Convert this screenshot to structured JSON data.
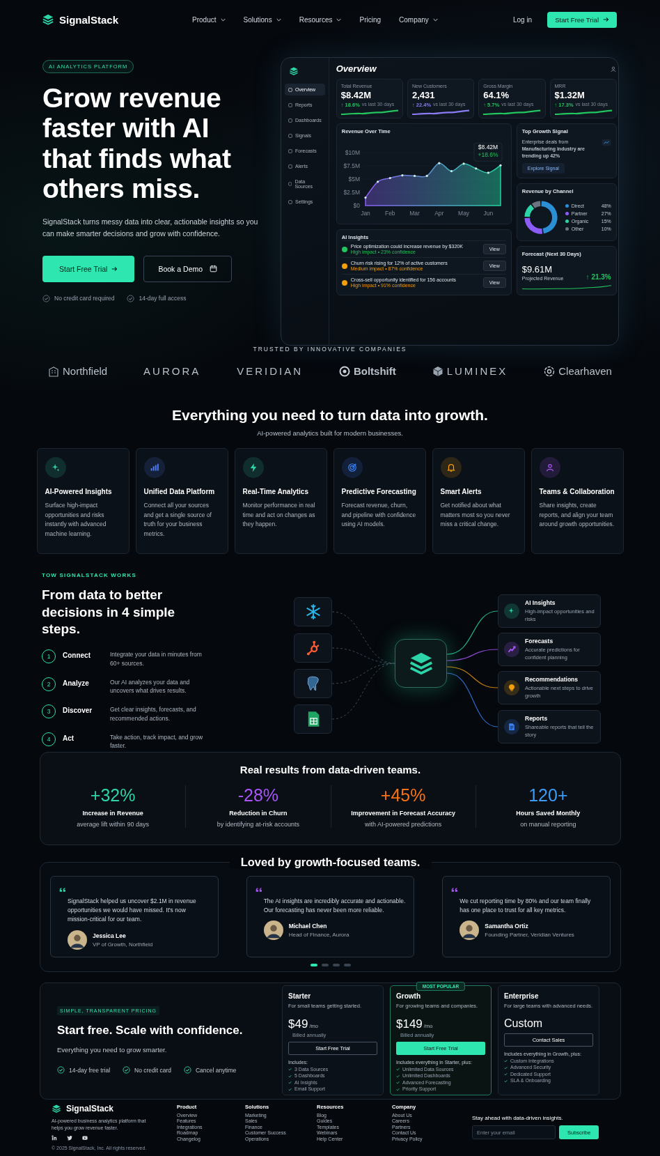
{
  "nav": {
    "brand": "SignalStack",
    "links": [
      {
        "label": "Product",
        "dropdown": true
      },
      {
        "label": "Solutions",
        "dropdown": true
      },
      {
        "label": "Resources",
        "dropdown": true
      },
      {
        "label": "Pricing",
        "dropdown": false
      },
      {
        "label": "Company",
        "dropdown": true
      }
    ],
    "login": "Log in",
    "cta": "Start Free Trial"
  },
  "hero": {
    "badge": "AI ANALYTICS PLATFORM",
    "headline": "Grow revenue faster **with AI that finds what others miss.**",
    "description": "SignalStack turns messy data into clear, actionable insights so you can make smarter decisions and grow with confidence.",
    "primary_button": "Start Free Trial",
    "secondary_button": "Book a Demo",
    "assurances": [
      "No credit card required",
      "14-day full access"
    ]
  },
  "dashboard": {
    "title": "Overview",
    "sidebar": [
      {
        "label": "Overview",
        "selected": true
      },
      {
        "label": "Reports",
        "selected": false
      },
      {
        "label": "Dashboards",
        "selected": false
      },
      {
        "label": "Signals",
        "selected": false
      },
      {
        "label": "Forecasts",
        "selected": false
      },
      {
        "label": "Alerts",
        "selected": false
      },
      {
        "label": "Data Sources",
        "selected": false
      },
      {
        "label": "Settings",
        "selected": false
      }
    ],
    "kpis": [
      {
        "label": "Total Revenue",
        "value": "$8.42M",
        "change": "↑ 18.6%",
        "note": "vs last 30 days",
        "color": "#22c55e"
      },
      {
        "label": "New Customers",
        "value": "2,431",
        "change": "↑ 22.4%",
        "note": "vs last 30 days",
        "color": "#8b7cf6"
      },
      {
        "label": "Gross Margin",
        "value": "64.1%",
        "change": "↑ 5.7%",
        "note": "vs last 30 days",
        "color": "#22c55e"
      },
      {
        "label": "MRR",
        "value": "$1.32M",
        "change": "↑ 17.3%",
        "note": "vs last 30 days",
        "color": "#22c55e"
      }
    ],
    "revenue_chart": {
      "title": "Revenue Over Time",
      "chart_data": {
        "type": "area",
        "categories": [
          "Jan",
          null,
          "Feb",
          null,
          "Mar",
          null,
          "Apr",
          null,
          "May",
          null,
          "Jun",
          null
        ],
        "series": [
          {
            "color": "#22d3a0",
            "values": [
              1.5,
              4.5,
              5.2,
              5.7,
              5.6,
              5.6,
              8.0,
              6.5,
              7.9,
              7.0,
              6.2,
              7.6
            ]
          }
        ],
        "ylim": [
          0,
          10
        ],
        "yticks": [
          {
            "value": 0,
            "label": "$0"
          },
          {
            "value": 2.5,
            "label": "$2.5M"
          },
          {
            "value": 5,
            "label": "$5M"
          },
          {
            "value": 7.5,
            "label": "$7.5M"
          },
          {
            "value": 10,
            "label": "$10M"
          }
        ],
        "annotations": [
          "$8.42M",
          "+18.6%"
        ]
      }
    },
    "growth_signal": {
      "title": "Top Growth Signal",
      "text": "Enterprise deals from **Manufacturing industry are trending up 42%**",
      "button": "Explore Signal"
    },
    "channels": {
      "title": "Revenue by Channel",
      "chart_data": {
        "type": "donut",
        "categories": [
          "Direct",
          "Partner",
          "Organic",
          "Other"
        ],
        "values": [
          48,
          27,
          15,
          10
        ],
        "value_labels": [
          "48%",
          "27%",
          "15%",
          "10%"
        ],
        "colors": [
          "#2b8fd6",
          "#8b5cf6",
          "#2dd4a8",
          "#6b7280"
        ]
      }
    },
    "insights": {
      "title": "AI Insights",
      "items": [
        {
          "text": "Price optimization could increase revenue by $320K",
          "meta": "High impact • 23% confidence",
          "color": "#22c55e",
          "button": "View"
        },
        {
          "text": "Churn risk rising for 12% of active customers",
          "meta": "Medium impact • 87% confidence",
          "color": "#f59e0b",
          "button": "View"
        },
        {
          "text": "Cross-sell opportunity identified for 156 accounts",
          "meta": "High impact • 91% confidence",
          "color": "#f59e0b",
          "button": "View"
        }
      ]
    },
    "forecast": {
      "title": "Forecast (Next 30 Days)",
      "value": "$9.61M",
      "label": "Projected Revenue",
      "change": "↑ 21.3%"
    }
  },
  "trusted": {
    "label": "TRUSTED BY INNOVATIVE COMPANIES",
    "logos": [
      "Northfield",
      "AURORA",
      "VERIDIAN",
      "Boltshift",
      "LUMINEX",
      "Clearhaven"
    ]
  },
  "features": {
    "title": "Everything you need to turn data into growth.",
    "subtitle": "AI-powered analytics built for modern businesses.",
    "cards": [
      {
        "title": "AI-Powered Insights",
        "text": "Surface high-impact opportunities and risks instantly with advanced machine learning.",
        "color": "#2dd4a8"
      },
      {
        "title": "Unified Data Platform",
        "text": "Connect all your sources and get a single source of truth for your business metrics.",
        "color": "#4f7df0"
      },
      {
        "title": "Real-Time Analytics",
        "text": "Monitor performance in real time and act on changes as they happen.",
        "color": "#2dd4a8"
      },
      {
        "title": "Predictive Forecasting",
        "text": "Forecast revenue, churn, and pipeline with confidence using AI models.",
        "color": "#3b82f6"
      },
      {
        "title": "Smart Alerts",
        "text": "Get notified about what matters most so you never miss a critical change.",
        "color": "#f59e0b"
      },
      {
        "title": "Teams & Collaboration",
        "text": "Share insights, create reports, and align your team around growth opportunities.",
        "color": "#a855f7"
      }
    ]
  },
  "how": {
    "eyebrow": "TOW SIGNALSTACK WORKS",
    "title": "From data to better decisions in 4 simple steps.",
    "steps": [
      {
        "number": "1",
        "title": "Connect",
        "text": "Integrate your data in minutes from 60+ sources."
      },
      {
        "number": "2",
        "title": "Analyze",
        "text": "Our AI analyzes your data and uncovers what drives results."
      },
      {
        "number": "3",
        "title": "Discover",
        "text": "Get clear insights, forecasts, and recommended actions."
      },
      {
        "number": "4",
        "title": "Act",
        "text": "Take action, track impact, and grow faster."
      }
    ],
    "outputs": [
      {
        "title": "AI Insights",
        "text": "High-impact opportunities and risks",
        "color": "#2dd4a8"
      },
      {
        "title": "Forecasts",
        "text": "Accurate predictions for confident planning",
        "color": "#a855f7"
      },
      {
        "title": "Recommendations",
        "text": "Actionable next steps to drive growth",
        "color": "#f59e0b"
      },
      {
        "title": "Reports",
        "text": "Shareable reports that tell the story",
        "color": "#3b82f6"
      }
    ]
  },
  "results": {
    "title": "Real results from data-driven teams.",
    "stats": [
      {
        "value": "+32%",
        "label": "Increase in Revenue",
        "note": "average lift within 90 days",
        "color": "#2dd4a8"
      },
      {
        "value": "-28%",
        "label": "Reduction in Churn",
        "note": "by identifying at-risk accounts",
        "color": "#a855f7"
      },
      {
        "value": "+45%",
        "label": "Improvement in Forecast Accuracy",
        "note": "with AI-powered predictions",
        "color": "#f97316"
      },
      {
        "value": "120+",
        "label": "Hours Saved Monthly",
        "note": "on manual reporting",
        "color": "#3b9cf6"
      }
    ]
  },
  "testimonials": {
    "title": "Loved by growth-focused teams.",
    "items": [
      {
        "quote": "SignalStack helped us uncover $2.1M in revenue opportunities we would have missed. It's now mission-critical for our team.",
        "name": "Jessica Lee",
        "role": "VP of Growth, Northfield",
        "color": "#2dd4a8"
      },
      {
        "quote": "The AI insights are incredibly accurate and actionable. Our forecasting has never been more reliable.",
        "name": "Michael Chen",
        "role": "Head of Finance, Aurora",
        "color": "#a855f7"
      },
      {
        "quote": "We cut reporting time by 80% and our team finally has one place to trust for all key metrics.",
        "name": "Samantha Ortiz",
        "role": "Founding Partner, Veridian Ventures",
        "color": "#a855f7"
      }
    ],
    "dots": [
      {
        "selected": true
      },
      {
        "selected": false
      },
      {
        "selected": false
      },
      {
        "selected": false
      }
    ]
  },
  "pricing": {
    "eyebrow": "SIMPLE, TRANSPARENT PRICING",
    "title": "Start free. Scale with confidence.",
    "subtitle": "Everything you need to grow smarter.",
    "perks": [
      "14-day free trial",
      "No credit card",
      "Cancel anytime"
    ],
    "plans": [
      {
        "name": "Starter",
        "description": "For small teams getting started.",
        "price": "$49",
        "period": "/mo",
        "billing": "Billed annually",
        "button": "Start Free Trial",
        "includes": "Includes:",
        "features": [
          "3 Data Sources",
          "5 Dashboards",
          "AI Insights",
          "Email Support"
        ],
        "featured": false
      },
      {
        "name": "Growth",
        "badge": "MOST POPULAR",
        "description": "For growing teams and companies.",
        "price": "$149",
        "period": "/mo",
        "billing": "Billed annually",
        "button": "Start Free Trial",
        "includes": "Includes everything in Starter, plus:",
        "features": [
          "Unlimited Data Sources",
          "Unlimited Dashboards",
          "Advanced Forecasting",
          "Priority Support"
        ],
        "featured": true
      },
      {
        "name": "Enterprise",
        "description": "For large teams with advanced needs.",
        "price": "Custom",
        "button": "Contact Sales",
        "includes": "Includes everything in Growth, plus:",
        "features": [
          "Custom Integrations",
          "Advanced Security",
          "Dedicated Support",
          "SLA & Onboarding"
        ],
        "featured": false
      }
    ]
  },
  "footer": {
    "brand": "SignalStack",
    "tagline": "AI-powered business analytics platform that helps you grow revenue faster.",
    "copyright": "© 2025 SignalStack, Inc. All rights reserved.",
    "columns": [
      {
        "title": "Product",
        "links": [
          "Overview",
          "Features",
          "Integrations",
          "Roadmap",
          "Changelog"
        ]
      },
      {
        "title": "Solutions",
        "links": [
          "Marketing",
          "Sales",
          "Finance",
          "Customer Success",
          "Operations"
        ]
      },
      {
        "title": "Resources",
        "links": [
          "Blog",
          "Guides",
          "Templates",
          "Webinars",
          "Help Center"
        ]
      },
      {
        "title": "Company",
        "links": [
          "About Us",
          "Careers",
          "Partners",
          "Contact Us",
          "Privacy Policy"
        ]
      }
    ],
    "newsletter": {
      "title": "Stay ahead with data-driven insights.",
      "placeholder": "Enter your email",
      "button": "Subscribe"
    }
  }
}
